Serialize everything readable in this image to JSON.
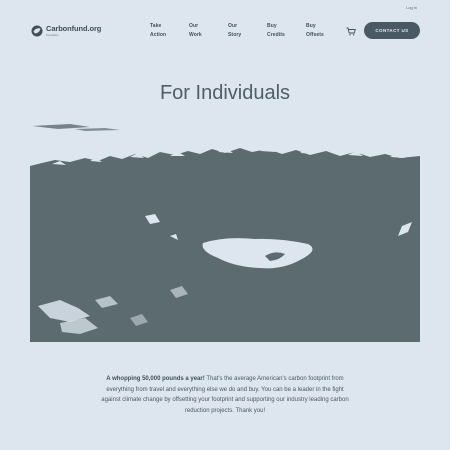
{
  "header": {
    "login_label": "Log in",
    "logo_text": "Carbonfund.org",
    "logo_tagline": "Foundation",
    "nav": [
      {
        "line1": "Take",
        "line2": "Action"
      },
      {
        "line1": "Our",
        "line2": "Work"
      },
      {
        "line1": "Our",
        "line2": "Story"
      },
      {
        "line1": "Buy",
        "line2": "Credits"
      },
      {
        "line1": "Buy",
        "line2": "Offsets"
      }
    ],
    "cart_icon": "cart-icon",
    "contact_label": "CONTACT US"
  },
  "main": {
    "title": "For Individuals",
    "intro_bold": "A whopping 50,000 pounds a year!",
    "intro_text": " That's the average American's carbon footprint from everything from travel and everything else we do and buy. You can be a leader in the fight against climate change by offsetting your footprint and supporting our industry leading carbon reduction projects. Thank you!"
  },
  "colors": {
    "background": "#dde5ee",
    "hero_dark": "#5b6b6f",
    "button": "#4a5a62"
  }
}
